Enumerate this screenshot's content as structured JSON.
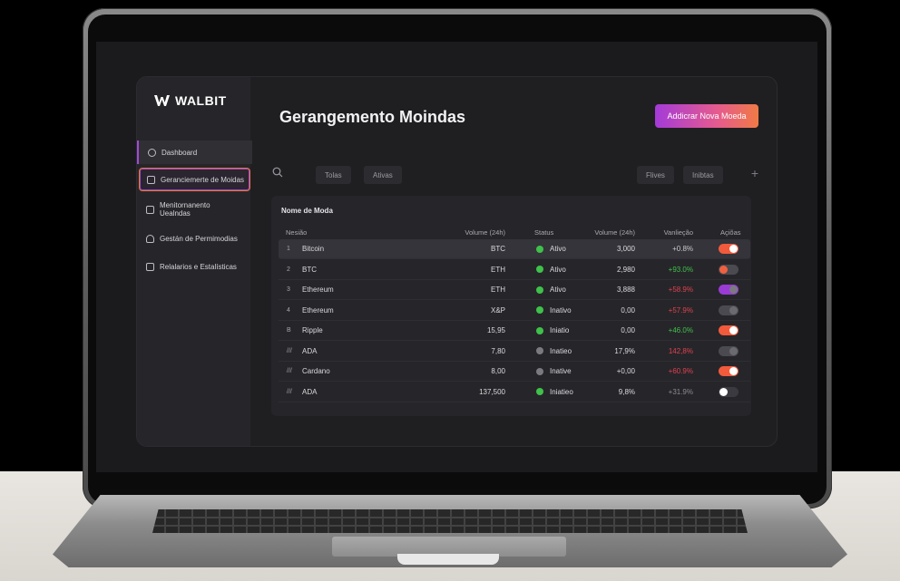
{
  "app": {
    "logo": "WALBIT",
    "title": "Gerangemento Moindas",
    "add_button": "Addicrar Nova Moeda"
  },
  "sidebar": {
    "items": [
      {
        "label": "Dashboard"
      },
      {
        "label": "Geranciemerte de Moidas"
      },
      {
        "label": "Menitornanento Uealndas"
      },
      {
        "label": "Gestán de Permimodias"
      },
      {
        "label": "Relalarios e Estalísticas"
      }
    ]
  },
  "toolbar": {
    "chips_left": [
      "Tolas",
      "Ativas"
    ],
    "chips_right": [
      "Flives",
      "Inibtas"
    ],
    "plus": "+"
  },
  "table": {
    "title": "Nome de Moda",
    "headers": {
      "name": "Nesião",
      "volume1": "Volume (24h)",
      "status": "Status",
      "volume2": "Volume (24h)",
      "variation": "Vanlieção",
      "actions": "Açiõas"
    },
    "rows": [
      {
        "idx": "1",
        "name": "Bitcoin",
        "vol1": "BTC",
        "status": "Ativo",
        "status_color": "#3fc14a",
        "vol2": "3,000",
        "var": "+0.8%",
        "var_color": "#c9c9cc",
        "toggle_color": "#f25a3c",
        "toggle_on": true,
        "selected": true
      },
      {
        "idx": "2",
        "name": "BTC",
        "vol1": "ETH",
        "status": "Ativo",
        "status_color": "#3fc14a",
        "vol2": "2,980",
        "var": "+93.0%",
        "var_color": "#3fc14a",
        "toggle_color": "#4a4a50",
        "toggle_on": false,
        "knob_color": "#f06040",
        "selected": false
      },
      {
        "idx": "3",
        "name": "Ethereum",
        "vol1": "ETH",
        "status": "Ativo",
        "status_color": "#3fc14a",
        "vol2": "3,888",
        "var": "+58.9%",
        "var_color": "#e0414e",
        "toggle_color": "#9a3bd6",
        "toggle_on": true,
        "knob_color": "#7a7a80",
        "selected": false
      },
      {
        "idx": "4",
        "name": "Ethereum",
        "vol1": "X&P",
        "status": "Inativo",
        "status_color": "#3fc14a",
        "vol2": "0,00",
        "var": "+57.9%",
        "var_color": "#e0414e",
        "toggle_color": "#4a4a50",
        "toggle_on": true,
        "knob_color": "#6a6a70",
        "selected": false
      },
      {
        "idx": "B",
        "name": "Ripple",
        "vol1": "15,95",
        "status": "Iniatio",
        "status_color": "#3fc14a",
        "vol2": "0,00",
        "var": "+46.0%",
        "var_color": "#3fc14a",
        "toggle_color": "#f25a3c",
        "toggle_on": true,
        "selected": false
      },
      {
        "idx": "///",
        "name": "ADA",
        "vol1": "7,80",
        "status": "Inatieo",
        "status_color": "#7a7a80",
        "vol2": "17,9%",
        "var": "142,8%",
        "var_color": "#e0414e",
        "toggle_color": "#4a4a50",
        "toggle_on": true,
        "knob_color": "#6a6a70",
        "selected": false
      },
      {
        "idx": "///",
        "name": "Cardano",
        "vol1": "8,00",
        "status": "Inative",
        "status_color": "#7a7a80",
        "vol2": "+0,00",
        "var": "+60.9%",
        "var_color": "#e0414e",
        "toggle_color": "#f25a3c",
        "toggle_on": true,
        "selected": false
      },
      {
        "idx": "///",
        "name": "ADA",
        "vol1": "137,500",
        "status": "Iniatieo",
        "status_color": "#3fc14a",
        "vol2": "9,8%",
        "var": "+31.9%",
        "var_color": "#8a8a90",
        "toggle_color": "#3a3a40",
        "toggle_on": false,
        "knob_color": "#ffffff",
        "selected": false
      }
    ]
  }
}
